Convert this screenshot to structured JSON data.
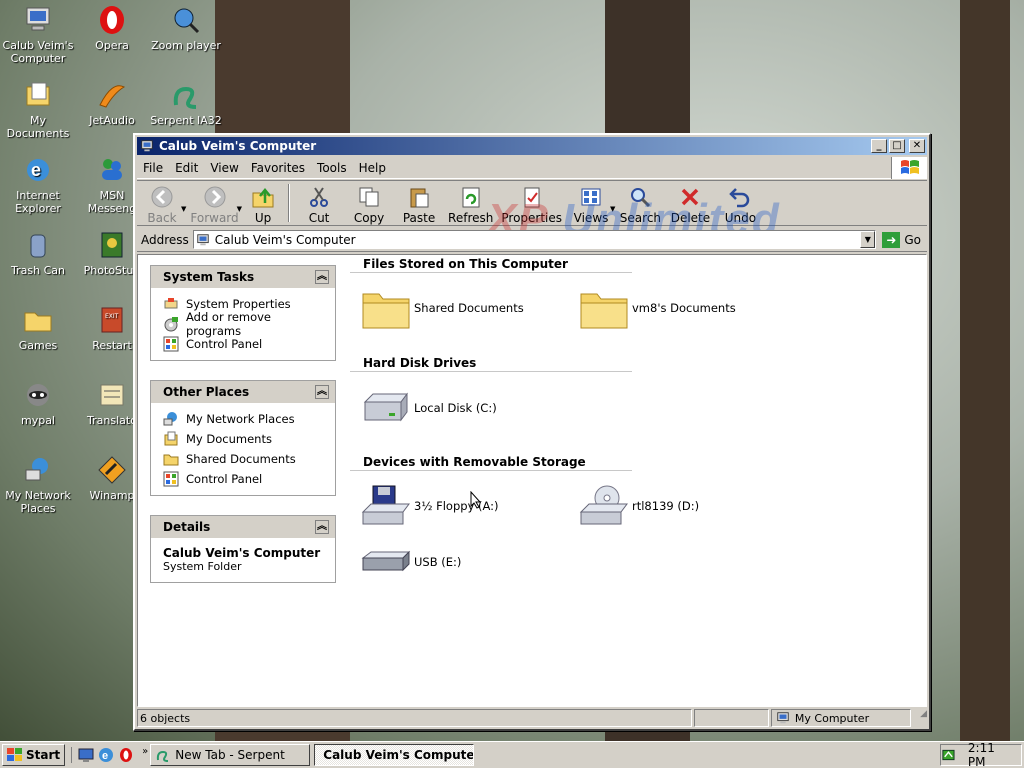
{
  "desktop": {
    "icons": [
      {
        "label": "Calub Veim's Computer",
        "icon": "my-computer-icon"
      },
      {
        "label": "Opera",
        "icon": "opera-icon"
      },
      {
        "label": "Zoom player",
        "icon": "zoom-player-icon"
      },
      {
        "label": "My Documents",
        "icon": "my-documents-icon"
      },
      {
        "label": "JetAudio",
        "icon": "jetaudio-icon"
      },
      {
        "label": "Serpent IA32",
        "icon": "serpent-icon"
      },
      {
        "label": "Internet Explorer",
        "icon": "internet-explorer-icon"
      },
      {
        "label": "MSN Messeng",
        "icon": "msn-icon"
      },
      {
        "label": "Trash Can",
        "icon": "trash-can-icon"
      },
      {
        "label": "PhotoStud",
        "icon": "photostudio-icon"
      },
      {
        "label": "Games",
        "icon": "games-folder-icon"
      },
      {
        "label": "Restart",
        "icon": "restart-icon"
      },
      {
        "label": "mypal",
        "icon": "mypal-icon"
      },
      {
        "label": "Translato",
        "icon": "translator-icon"
      },
      {
        "label": "My Network Places",
        "icon": "network-places-icon"
      },
      {
        "label": "Winamp",
        "icon": "winamp-icon"
      }
    ]
  },
  "window": {
    "title": "Calub Veim's Computer",
    "controls": {
      "minimize": "_",
      "maximize": "□",
      "close": "✕"
    },
    "menu": [
      "File",
      "Edit",
      "View",
      "Favorites",
      "Tools",
      "Help"
    ],
    "toolbar": {
      "back": "Back",
      "forward": "Forward",
      "up": "Up",
      "cut": "Cut",
      "copy": "Copy",
      "paste": "Paste",
      "refresh": "Refresh",
      "properties": "Properties",
      "views": "Views",
      "search": "Search",
      "delete": "Delete",
      "undo": "Undo"
    },
    "watermark": {
      "part1": "XP",
      "part2": "Unlimited"
    },
    "address": {
      "label": "Address",
      "value": "Calub Veim's Computer",
      "go": "Go"
    },
    "panels": {
      "system_tasks": {
        "title": "System Tasks",
        "links": [
          "System Properties",
          "Add or remove programs",
          "Control Panel"
        ]
      },
      "other_places": {
        "title": "Other Places",
        "links": [
          "My Network Places",
          "My Documents",
          "Shared Documents",
          "Control Panel"
        ]
      },
      "details": {
        "title": "Details",
        "name": "Calub Veim's Computer",
        "type": "System Folder"
      }
    },
    "sections": {
      "files": {
        "title": "Files Stored on This Computer",
        "items": [
          "Shared Documents",
          "vm8's Documents"
        ]
      },
      "hdd": {
        "title": "Hard Disk Drives",
        "items": [
          "Local Disk (C:)"
        ]
      },
      "removable": {
        "title": "Devices with Removable Storage",
        "items": [
          "3½ Floppy (A:)",
          "rtl8139 (D:)",
          "USB (E:)"
        ]
      }
    },
    "status": {
      "count": "6 objects",
      "location": "My Computer"
    }
  },
  "taskbar": {
    "start": "Start",
    "more": "»",
    "tasks": [
      {
        "label": "New Tab - Serpent",
        "active": false
      },
      {
        "label": "Calub Veim's Computer",
        "active": true
      }
    ],
    "clock": "2:11 PM"
  },
  "colors": {
    "title_start": "#0a246a",
    "title_end": "#a6caf0",
    "face": "#d4d0c8"
  }
}
